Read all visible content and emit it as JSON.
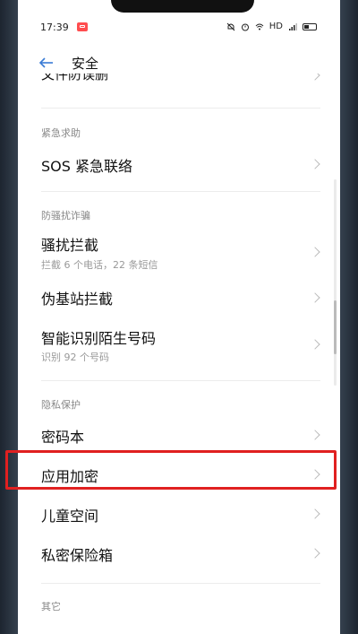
{
  "status_bar": {
    "time": "17:39",
    "hd_label": "HD",
    "icons": [
      "notification-icon",
      "mute-icon",
      "alarm-icon",
      "wifi-icon",
      "signal-icon",
      "battery-icon"
    ]
  },
  "header": {
    "back_icon": "back-arrow-icon",
    "title": "安全"
  },
  "partial_top_item": "文件防误删",
  "sections": [
    {
      "header": "紧急求助",
      "items": [
        {
          "title": "SOS 紧急联络",
          "subtitle": ""
        }
      ]
    },
    {
      "header": "防骚扰诈骗",
      "items": [
        {
          "title": "骚扰拦截",
          "subtitle": "拦截 6 个电话，22 条短信"
        },
        {
          "title": "伪基站拦截",
          "subtitle": ""
        },
        {
          "title": "智能识别陌生号码",
          "subtitle": "识别 92 个号码"
        }
      ]
    },
    {
      "header": "隐私保护",
      "items": [
        {
          "title": "密码本",
          "subtitle": ""
        },
        {
          "title": "应用加密",
          "subtitle": ""
        },
        {
          "title": "儿童空间",
          "subtitle": ""
        },
        {
          "title": "私密保险箱",
          "subtitle": ""
        }
      ]
    },
    {
      "header": "其它",
      "items": []
    }
  ],
  "highlighted_item": "应用加密",
  "colors": {
    "highlight": "#e02020",
    "background": "#ffffff",
    "section_header": "#888888"
  }
}
